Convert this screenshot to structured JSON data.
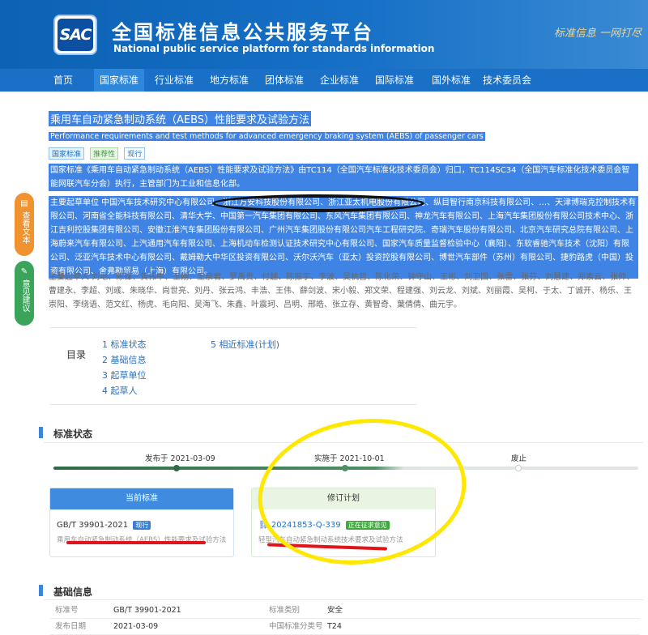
{
  "header": {
    "logo_text": "SAC",
    "title": "全国标准信息公共服务平台",
    "subtitle": "National public service platform  for standards information",
    "slogan": "标准信息 一网打尽"
  },
  "nav": [
    "首页",
    "国家标准",
    "行业标准",
    "地方标准",
    "团体标准",
    "企业标准",
    "国际标准",
    "国外标准",
    "技术委员会"
  ],
  "standard": {
    "title_cn": "乘用车自动紧急制动系统（AEBS）性能要求及试验方法",
    "title_en": "Performance requirements and test methods for advanced emergency braking system (AEBS) of passenger cars",
    "tags": [
      "国家标准",
      "推荐性",
      "现行"
    ]
  },
  "paragraphs": {
    "p1": "国家标准《乘用车自动紧急制动系统（AEBS）性能要求及试验方法》由TC114（全国汽车标准化技术委员会）归口，TC114SC34（全国汽车标准化技术委员会智能网联汽车分会）执行，主管部门为工业和信息化部。",
    "p2": "主要起草单位 中国汽车技术研究中心有限公司、浙江万安科技股份有限公司、浙江亚太机电股份有限公司、纵目智行南京科技有限公司、…、天津博瑞克控制技术有限公司、河南省全能科技有限公司、清华大学、中国第一汽车集团有限公司、东风汽车集团有限公司、神龙汽车有限公司、上海汽车集团股份有限公司技术中心、浙江吉利控股集团有限公司、安徽江淮汽车集团股份有限公司、广州汽车集团股份有限公司汽车工程研究院、奇瑞汽车股份有限公司、北京汽车研究总院有限公司、上海蔚来汽车有限公司、上汽通用汽车有限公司、上海机动车检测认证技术研究中心有限公司、国家汽车质量监督检验中心（襄阳）、东软睿驰汽车技术（沈阳）有限公司、泛亚汽车技术中心有限公司、戴姆勒大中华区投资有限公司、沃尔沃汽车（亚太）投资控股有限公司、博世汽车部件（苏州）有限公司、捷豹路虎（中国）投资有限公司、舍弗勒贸易（上海）有限公司。",
    "p3": "主要起草人 刘地、陈锋、黄伟中、王刚、王泉君、罗禹贡、付越、陈振宇、李波、吴杭哲、陈化荣、钟守山、王彬、刘卫国、张雷、张芬、刘慧建、郑素云、张帅、曹建永、李超、刘彧、朱晓华、尚世亮、刘丹、张云鸿、丰浩、王伟、薛剑波、宋小毅、郑文荣、程建强、刘云龙、刘斌、刘丽霞、吴柯、于太、丁诚开、杨乐、王崇阳、李绕语、范文红、杨虎、毛向阳、吴海飞、朱鑫、叶震珂、吕明、邢皓、张立存、黄智奇、葉倩倩、曲元宇。"
  },
  "side": {
    "view_text": "查看文本",
    "feedback": "意见建议"
  },
  "toc": {
    "title": "目录",
    "items": [
      "1 标准状态",
      "2 基础信息",
      "3 起草单位",
      "4 起草人",
      "5 相近标准(计划)"
    ]
  },
  "status": {
    "section_title": "标准状态",
    "published": "发布于 2021-03-09",
    "implemented": "实施于 2021-10-01",
    "abolished": "废止"
  },
  "current_card": {
    "head": "当前标准",
    "code": "GB/T 39901-2021",
    "badge": "现行",
    "name": "乘用车自动紧急制动系统（AEBS）性能要求及试验方法"
  },
  "revision_card": {
    "head": "修订计划",
    "code": "20241853-Q-339",
    "badge": "正在征求意见",
    "name": "轻型汽车自动紧急制动系统技术要求及试验方法"
  },
  "basic_info": {
    "section_title": "基础信息",
    "rows": [
      {
        "l1": "标准号",
        "v1": "GB/T 39901-2021",
        "l2": "标准类别",
        "v2": "安全"
      },
      {
        "l1": "发布日期",
        "v1": "2021-03-09",
        "l2": "中国标准分类号",
        "v2": "T24"
      }
    ]
  },
  "colors": {
    "header_blue": "#0c62b4",
    "nav_blue": "#1a6fc6",
    "highlight_blue": "#3f84e5",
    "annotation_yellow": "#ffe800",
    "annotation_red": "#e0141a"
  }
}
